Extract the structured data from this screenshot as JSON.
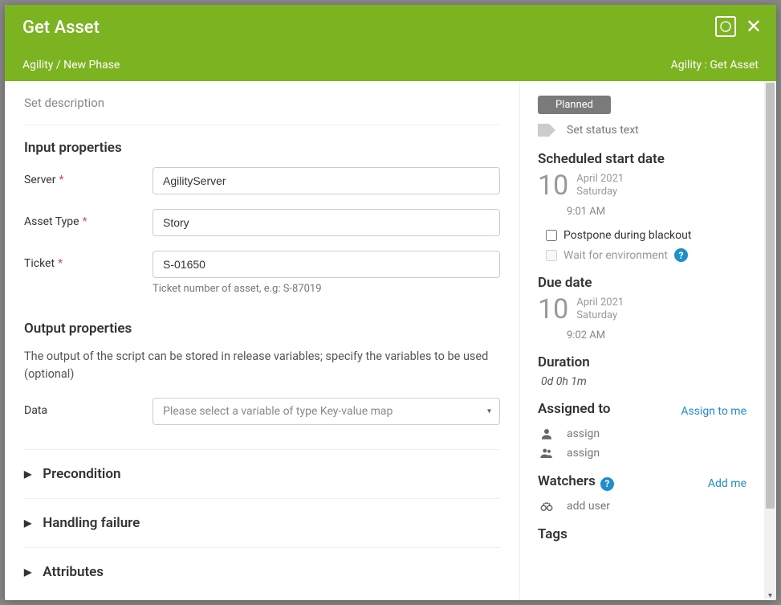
{
  "header": {
    "title": "Get Asset",
    "breadcrumb": "Agility / New Phase",
    "context": "Agility : Get Asset"
  },
  "main": {
    "description_placeholder": "Set description",
    "input_section": "Input properties",
    "server": {
      "label": "Server",
      "value": "AgilityServer"
    },
    "asset_type": {
      "label": "Asset Type",
      "value": "Story"
    },
    "ticket": {
      "label": "Ticket",
      "value": "S-01650",
      "hint": "Ticket number of asset, e.g: S-87019"
    },
    "output_section": "Output properties",
    "output_desc": "The output of the script can be stored in release variables; specify the variables to be used (optional)",
    "data": {
      "label": "Data",
      "placeholder": "Please select a variable of type Key-value map"
    },
    "accordion": {
      "precondition": "Precondition",
      "handling_failure": "Handling failure",
      "attributes": "Attributes"
    }
  },
  "side": {
    "status_badge": "Planned",
    "status_text_ph": "Set status text",
    "scheduled_h": "Scheduled start date",
    "start": {
      "day": "10",
      "monthyear": "April 2021",
      "weekday": "Saturday",
      "time": "9:01 AM"
    },
    "postpone_label": "Postpone during blackout",
    "wait_env_label": "Wait for environment",
    "due_h": "Due date",
    "due": {
      "day": "10",
      "monthyear": "April 2021",
      "weekday": "Saturday",
      "time": "9:02 AM"
    },
    "duration_h": "Duration",
    "duration_val": "0d 0h 1m",
    "assigned_h": "Assigned to",
    "assign_me": "Assign to me",
    "assign_ph": "assign",
    "watchers_h": "Watchers",
    "add_me": "Add me",
    "add_user_ph": "add user",
    "tags_h": "Tags"
  }
}
